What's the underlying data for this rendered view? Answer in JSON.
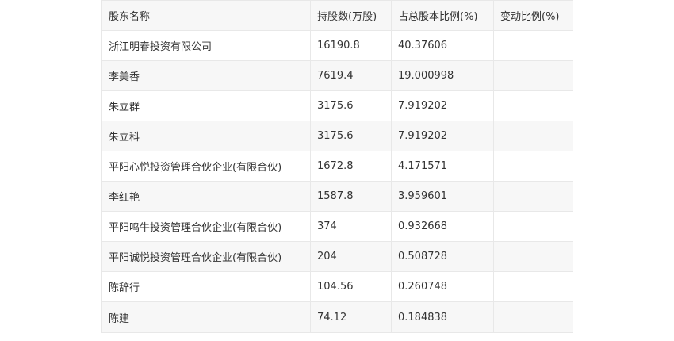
{
  "table": {
    "headers": [
      "股东名称",
      "持股数(万股)",
      "占总股本比例(%)",
      "变动比例(%)"
    ],
    "rows": [
      [
        "浙江明春投资有限公司",
        "16190.8",
        "40.37606",
        ""
      ],
      [
        "李美香",
        "7619.4",
        "19.000998",
        ""
      ],
      [
        "朱立群",
        "3175.6",
        "7.919202",
        ""
      ],
      [
        "朱立科",
        "3175.6",
        "7.919202",
        ""
      ],
      [
        "平阳心悦投资管理合伙企业(有限合伙)",
        "1672.8",
        "4.171571",
        ""
      ],
      [
        "李红艳",
        "1587.8",
        "3.959601",
        ""
      ],
      [
        "平阳鸣牛投资管理合伙企业(有限合伙)",
        "374",
        "0.932668",
        ""
      ],
      [
        "平阳诚悦投资管理合伙企业(有限合伙)",
        "204",
        "0.508728",
        ""
      ],
      [
        "陈辞行",
        "104.56",
        "0.260748",
        ""
      ],
      [
        "陈建",
        "74.12",
        "0.184838",
        ""
      ]
    ]
  }
}
